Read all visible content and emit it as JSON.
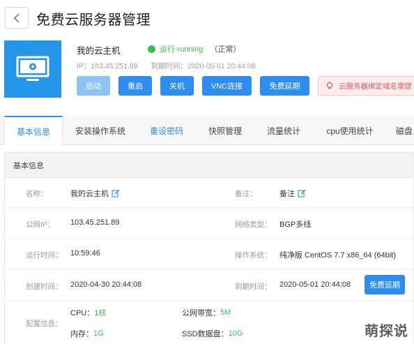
{
  "header": {
    "back_icon": "chevron-left-icon",
    "title": "免费云服务器管理"
  },
  "server": {
    "icon": "monitor-icon",
    "name": "我的云主机",
    "status_running": "运行-running",
    "status_normal": "（正常）",
    "status_color": "#3dbf55",
    "ip": "IP：103.45.251.89",
    "expire": "到期时间：2020-05-01 20:44:08"
  },
  "actions": {
    "start": "启动",
    "restart": "重启",
    "shutdown": "关机",
    "vnc": "VNC连接",
    "renew": "免费延期",
    "notice": "云服务器绑定域名需提"
  },
  "tabs": [
    {
      "label": "基本信息"
    },
    {
      "label": "安装操作系统"
    },
    {
      "label": "重设密码"
    },
    {
      "label": "快照管理"
    },
    {
      "label": "流量统计"
    },
    {
      "label": "cpu使用统计"
    },
    {
      "label": "磁盘"
    }
  ],
  "info": {
    "section_title": "基本信息",
    "name_label": "名称：",
    "name_value": "我的云主机",
    "note_label": "备注：",
    "note_value": "备注",
    "public_ip_label": "公网IP：",
    "public_ip_value": "103.45.251.89",
    "network_label": "网络类型：",
    "network_value": "BGP多线",
    "uptime_label": "运行时间：",
    "uptime_value": "10:59:46",
    "os_label": "操作系统：",
    "os_value": "纯净版 CentOS 7.7 x86_64 (64bit)",
    "created_label": "创建时间：",
    "created_value": "2020-04-30 20:44:08",
    "expire_label": "到期时间：",
    "expire_value": "2020-05-01 20:44:08",
    "renew_button": "免费延期",
    "config_label": "配置信息：",
    "cpu_label": "CPU：",
    "cpu_value": "1核",
    "bandwidth_label": "公网带宽：",
    "bandwidth_value": "5M",
    "memory_label": "内存：",
    "memory_value": "1G",
    "disk_label": "SSD数据盘：",
    "disk_value": "10G"
  },
  "watermark": "萌探说",
  "colors": {
    "accent": "#2d8df0",
    "tile": "#2495e8",
    "notice_text": "#e05a5a"
  }
}
